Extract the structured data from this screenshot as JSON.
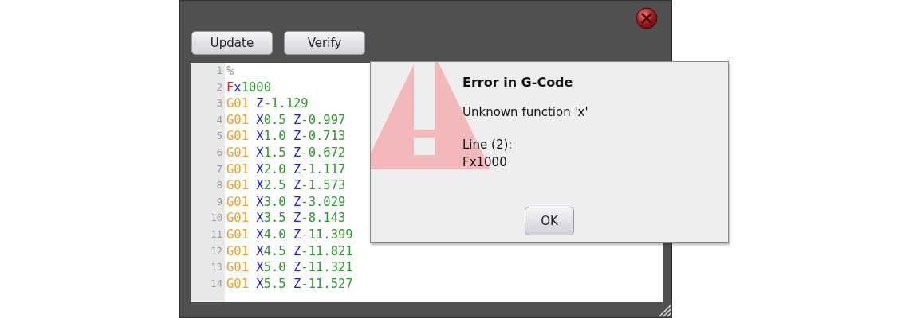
{
  "toolbar": {
    "buttons": [
      {
        "label": "Update"
      },
      {
        "label": "Verify"
      }
    ]
  },
  "editor": {
    "lines": [
      {
        "number": "1",
        "tokens": [
          {
            "text": "%",
            "kind": "comment"
          }
        ]
      },
      {
        "number": "2",
        "tokens": [
          {
            "text": "F",
            "kind": "error"
          },
          {
            "text": "x",
            "kind": "axis"
          },
          {
            "text": "1000",
            "kind": "number"
          }
        ]
      },
      {
        "number": "3",
        "tokens": [
          {
            "text": "G01",
            "kind": "command"
          },
          {
            "text": " Z",
            "kind": "axis"
          },
          {
            "text": "-1.129",
            "kind": "number"
          }
        ]
      },
      {
        "number": "4",
        "tokens": [
          {
            "text": "G01",
            "kind": "command"
          },
          {
            "text": " X",
            "kind": "axis"
          },
          {
            "text": "0.5",
            "kind": "number"
          },
          {
            "text": " Z",
            "kind": "axis"
          },
          {
            "text": "-0.997",
            "kind": "number"
          }
        ]
      },
      {
        "number": "5",
        "tokens": [
          {
            "text": "G01",
            "kind": "command"
          },
          {
            "text": " X",
            "kind": "axis"
          },
          {
            "text": "1.0",
            "kind": "number"
          },
          {
            "text": " Z",
            "kind": "axis"
          },
          {
            "text": "-0.713",
            "kind": "number"
          }
        ]
      },
      {
        "number": "6",
        "tokens": [
          {
            "text": "G01",
            "kind": "command"
          },
          {
            "text": " X",
            "kind": "axis"
          },
          {
            "text": "1.5",
            "kind": "number"
          },
          {
            "text": " Z",
            "kind": "axis"
          },
          {
            "text": "-0.672",
            "kind": "number"
          }
        ]
      },
      {
        "number": "7",
        "tokens": [
          {
            "text": "G01",
            "kind": "command"
          },
          {
            "text": " X",
            "kind": "axis"
          },
          {
            "text": "2.0",
            "kind": "number"
          },
          {
            "text": " Z",
            "kind": "axis"
          },
          {
            "text": "-1.117",
            "kind": "number"
          }
        ]
      },
      {
        "number": "8",
        "tokens": [
          {
            "text": "G01",
            "kind": "command"
          },
          {
            "text": " X",
            "kind": "axis"
          },
          {
            "text": "2.5",
            "kind": "number"
          },
          {
            "text": " Z",
            "kind": "axis"
          },
          {
            "text": "-1.573",
            "kind": "number"
          }
        ]
      },
      {
        "number": "9",
        "tokens": [
          {
            "text": "G01",
            "kind": "command"
          },
          {
            "text": " X",
            "kind": "axis"
          },
          {
            "text": "3.0",
            "kind": "number"
          },
          {
            "text": " Z",
            "kind": "axis"
          },
          {
            "text": "-3.029",
            "kind": "number"
          }
        ]
      },
      {
        "number": "10",
        "tokens": [
          {
            "text": "G01",
            "kind": "command"
          },
          {
            "text": " X",
            "kind": "axis"
          },
          {
            "text": "3.5",
            "kind": "number"
          },
          {
            "text": " Z",
            "kind": "axis"
          },
          {
            "text": "-8.143",
            "kind": "number"
          }
        ]
      },
      {
        "number": "11",
        "tokens": [
          {
            "text": "G01",
            "kind": "command"
          },
          {
            "text": " X",
            "kind": "axis"
          },
          {
            "text": "4.0",
            "kind": "number"
          },
          {
            "text": " Z",
            "kind": "axis"
          },
          {
            "text": "-11.399",
            "kind": "number"
          }
        ]
      },
      {
        "number": "12",
        "tokens": [
          {
            "text": "G01",
            "kind": "command"
          },
          {
            "text": " X",
            "kind": "axis"
          },
          {
            "text": "4.5",
            "kind": "number"
          },
          {
            "text": " Z",
            "kind": "axis"
          },
          {
            "text": "-11.821",
            "kind": "number"
          }
        ]
      },
      {
        "number": "13",
        "tokens": [
          {
            "text": "G01",
            "kind": "command"
          },
          {
            "text": " X",
            "kind": "axis"
          },
          {
            "text": "5.0",
            "kind": "number"
          },
          {
            "text": " Z",
            "kind": "axis"
          },
          {
            "text": "-11.321",
            "kind": "number"
          }
        ]
      },
      {
        "number": "14",
        "tokens": [
          {
            "text": "G01",
            "kind": "command"
          },
          {
            "text": " X",
            "kind": "axis"
          },
          {
            "text": "5.5",
            "kind": "number"
          },
          {
            "text": " Z",
            "kind": "axis"
          },
          {
            "text": "-11.527",
            "kind": "number"
          }
        ]
      }
    ]
  },
  "dialog": {
    "title": "Error in G-Code",
    "message": "Unknown function 'x'",
    "detail_label": "Line (2):",
    "detail_value": "Fx1000",
    "button": "OK"
  }
}
